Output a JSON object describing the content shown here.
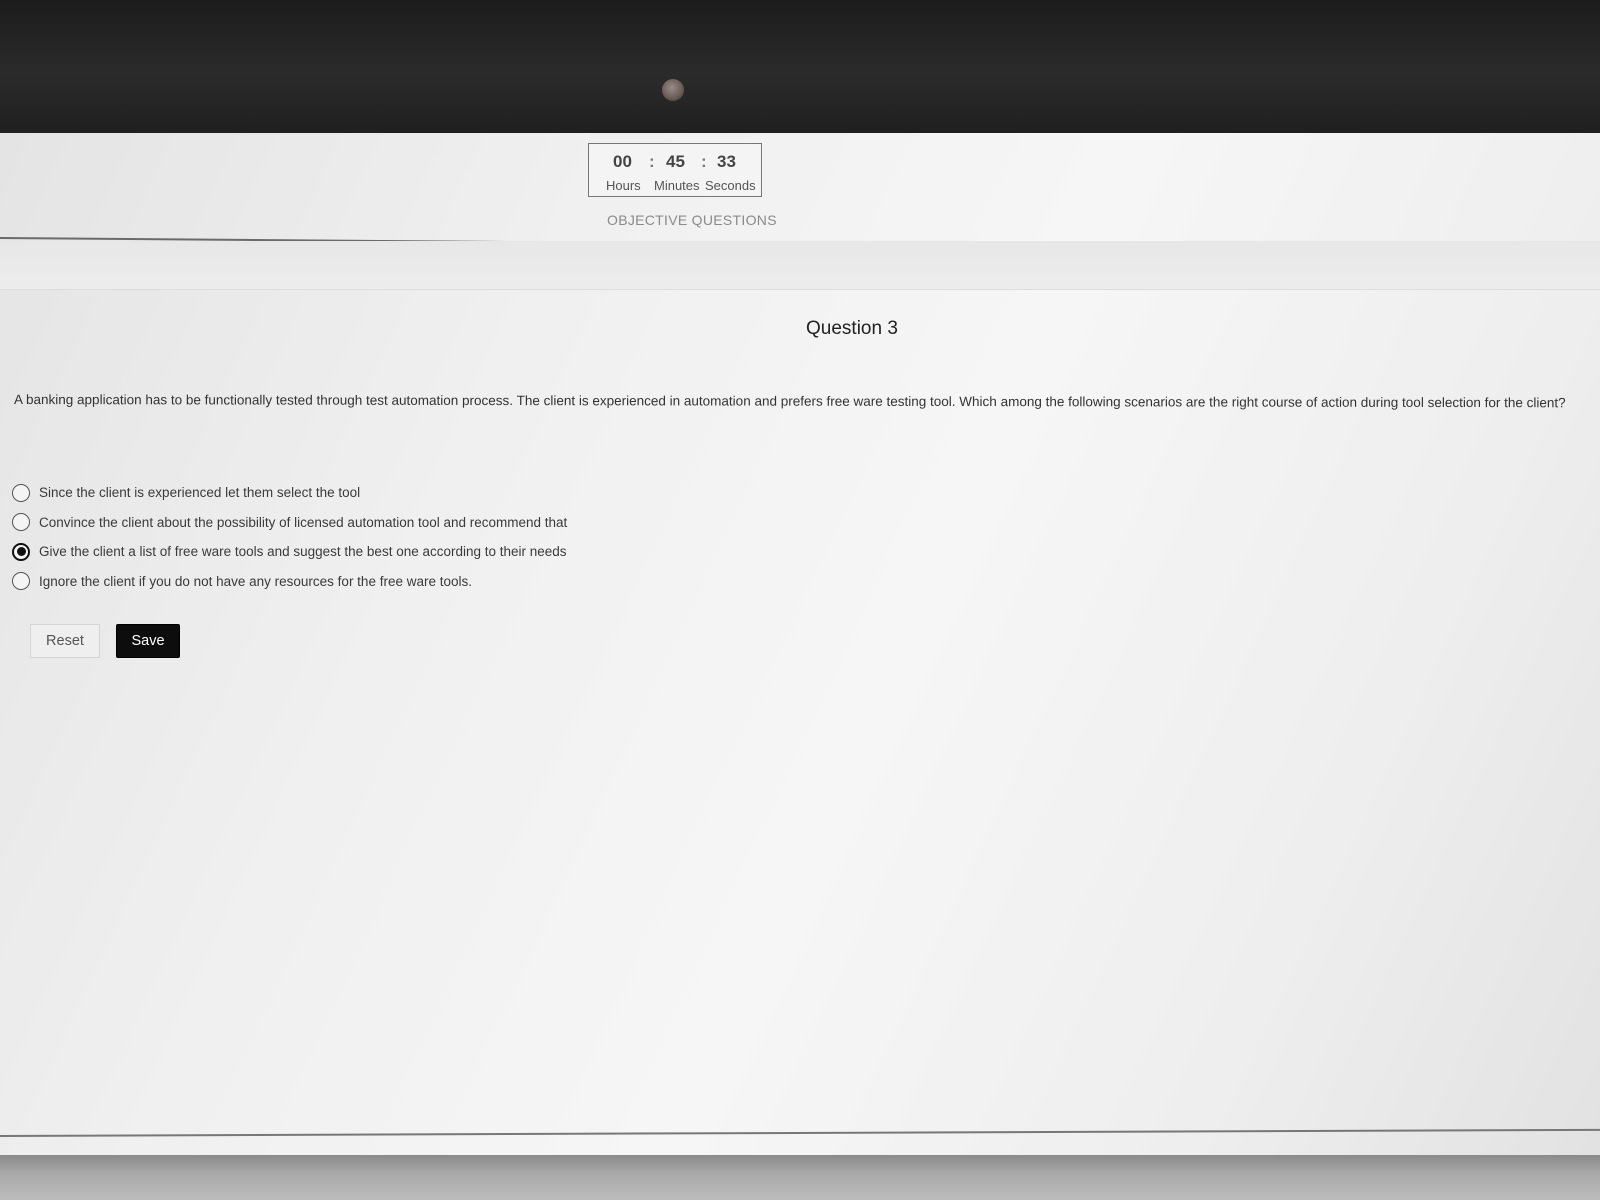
{
  "timer": {
    "hours": "00",
    "minutes": "45",
    "seconds": "33",
    "separator": ":",
    "hours_label": "Hours",
    "minutes_label": "Minutes",
    "seconds_label": "Seconds"
  },
  "section_title": "OBJECTIVE QUESTIONS",
  "question": {
    "heading": "Question 3",
    "text": "A banking application has to be functionally tested through test automation process. The client is experienced in automation and prefers free ware testing tool. Which among the following scenarios are the right course of action during tool selection for the client?",
    "options": [
      {
        "label": "Since the client is experienced let them select the tool",
        "selected": false
      },
      {
        "label": "Convince the client about the possibility of licensed automation tool and recommend that",
        "selected": false
      },
      {
        "label": "Give the client a list of free ware tools and suggest the best one according to their needs",
        "selected": true
      },
      {
        "label": "Ignore the client if you do not have any resources for the free ware tools.",
        "selected": false
      }
    ]
  },
  "buttons": {
    "reset_label": "Reset",
    "save_label": "Save"
  }
}
